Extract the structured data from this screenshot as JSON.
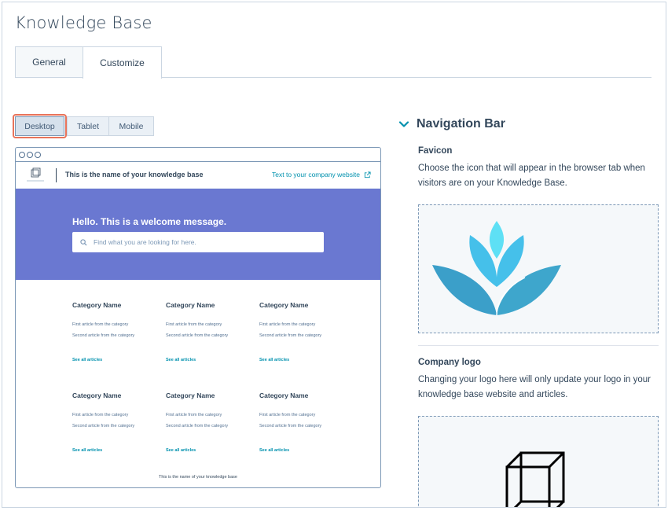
{
  "page_title": "Knowledge Base",
  "tabs": [
    {
      "label": "General"
    },
    {
      "label": "Customize",
      "active": true
    }
  ],
  "device_toggle": {
    "options": [
      "Desktop",
      "Tablet",
      "Mobile"
    ],
    "selected": "Desktop"
  },
  "preview": {
    "kb_name": "This is the name of your knowledge base",
    "website_link": "Text to your company website",
    "welcome": "Hello. This is a welcome message.",
    "search_placeholder": "Find what you are looking for here.",
    "categories": [
      {
        "name": "Category Name",
        "articles": [
          "First article from the category",
          "Second article from the category"
        ],
        "see_all": "See all articles"
      },
      {
        "name": "Category Name",
        "articles": [
          "First article from the category",
          "Second article from the category"
        ],
        "see_all": "See all articles"
      },
      {
        "name": "Category Name",
        "articles": [
          "First article from the category",
          "Second article from the category"
        ],
        "see_all": "See all articles"
      },
      {
        "name": "Category Name",
        "articles": [
          "First article from the category",
          "Second article from the category"
        ],
        "see_all": "See all articles"
      },
      {
        "name": "Category Name",
        "articles": [
          "First article from the category",
          "Second article from the category"
        ],
        "see_all": "See all articles"
      },
      {
        "name": "Category Name",
        "articles": [
          "First article from the category",
          "Second article from the category"
        ],
        "see_all": "See all articles"
      }
    ],
    "footer": "This is the name of your knowledge base",
    "hero_color": "#6a78d1"
  },
  "settings": {
    "section_title": "Navigation Bar",
    "favicon": {
      "label": "Favicon",
      "description": "Choose the icon that will appear in the browser tab when visitors are on your Knowledge Base."
    },
    "company_logo": {
      "label": "Company logo",
      "description": "Changing your logo here will only update your logo in your knowledge base website and articles."
    }
  },
  "icons": [
    "chevron-down-icon",
    "search-icon",
    "external-link-icon",
    "lotus-favicon-icon",
    "cube-logo-icon"
  ]
}
